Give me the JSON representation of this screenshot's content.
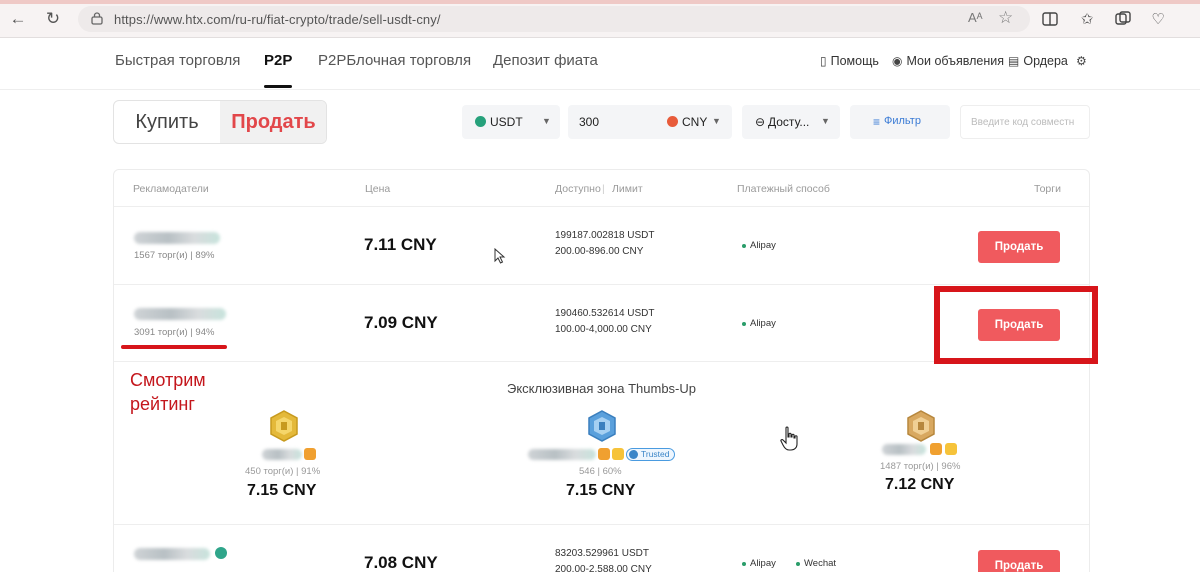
{
  "browser": {
    "url": "https://www.htx.com/ru-ru/fiat-crypto/trade/sell-usdt-cny/",
    "reader_label": "Aᴬ"
  },
  "nav": {
    "tabs": [
      "Быстрая торговля",
      "P2P",
      "P2PБлочная торговля",
      "Депозит фиата"
    ],
    "active_tab": "P2P",
    "help": "Помощь",
    "my_ads": "Мои объявления",
    "orders": "Ордера"
  },
  "filters": {
    "buy_label": "Купить",
    "sell_label": "Продать",
    "coin": "USDT",
    "amount": "300",
    "currency": "CNY",
    "payment": "Досту...",
    "filter_label": "Фильтр",
    "code_placeholder": "Введите код совместн"
  },
  "table": {
    "headers": {
      "advertisers": "Рекламодатели",
      "price": "Цена",
      "available": "Доступно",
      "limit": "Лимит",
      "payment": "Платежный способ",
      "trade": "Торги"
    },
    "rows": [
      {
        "stats": "1567 торг(и) | 89%",
        "price": "7.11 CNY",
        "available": "199187.002818 USDT",
        "limit": "200.00-896.00 CNY",
        "payment": [
          "Alipay"
        ],
        "action": "Продать"
      },
      {
        "stats": "3091 торг(и) | 94%",
        "price": "7.09 CNY",
        "available": "190460.532614 USDT",
        "limit": "100.00-4,000.00 CNY",
        "payment": [
          "Alipay"
        ],
        "action": "Продать"
      },
      {
        "stats": "",
        "price": "7.08 CNY",
        "available": "83203.529961 USDT",
        "limit": "200.00-2,588.00 CNY",
        "payment": [
          "Alipay",
          "Wechat"
        ],
        "action": "Продать"
      }
    ]
  },
  "thumbs_zone": {
    "title": "Эксклюзивная зона Thumbs-Up",
    "cards": [
      {
        "stats": "450 торг(и) | 91%",
        "price": "7.15 CNY",
        "medal_color": "#e4b93a"
      },
      {
        "stats": "546 | 60%",
        "price": "7.15 CNY",
        "medal_color": "#5aa0dc",
        "badge": "Trusted"
      },
      {
        "stats": "1487 торг(и) | 96%",
        "price": "7.12 CNY",
        "medal_color": "#d8a860"
      }
    ]
  },
  "annotation": {
    "line1": "Смотрим",
    "line2": "рейтинг"
  },
  "colors": {
    "sell_accent": "#e2474a",
    "button_red": "#f05a5e",
    "annotation_red": "#d7151a"
  }
}
